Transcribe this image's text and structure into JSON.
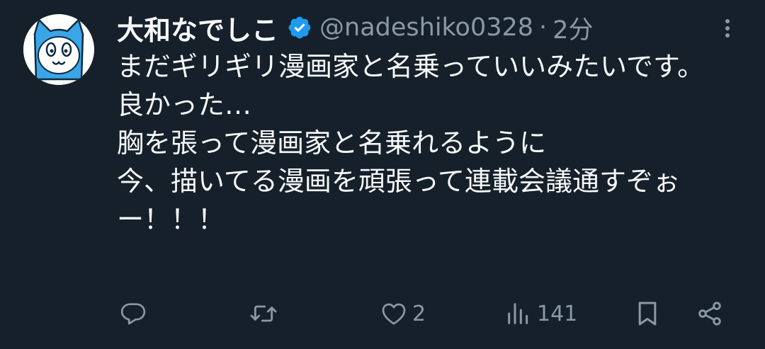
{
  "tweet": {
    "author": {
      "display_name": "大和なでしこ",
      "handle": "@nadeshiko0328",
      "verified_icon": "verified-badge-icon",
      "avatar_icon": "cat-face-avatar"
    },
    "separator": "·",
    "time": "2分",
    "text": "まだギリギリ漫画家と名乗っていいみたいです。\n良かった…\n胸を張って漫画家と名乗れるように\n今、描いてる漫画を頑張って連載会議通すぞぉー！！！",
    "actions": {
      "reply_icon": "reply-icon",
      "retweet_icon": "retweet-icon",
      "like_icon": "heart-icon",
      "like_count": "2",
      "views_icon": "views-icon",
      "views_count": "141",
      "bookmark_icon": "bookmark-icon",
      "share_icon": "share-icon"
    },
    "more_icon": "more-vertical-icon"
  },
  "colors": {
    "background": "#15202b",
    "text_primary": "#f7f9f9",
    "text_secondary": "#8b98a5",
    "verified_blue": "#1d9bf0",
    "avatar_blue": "#3aa6e8"
  }
}
